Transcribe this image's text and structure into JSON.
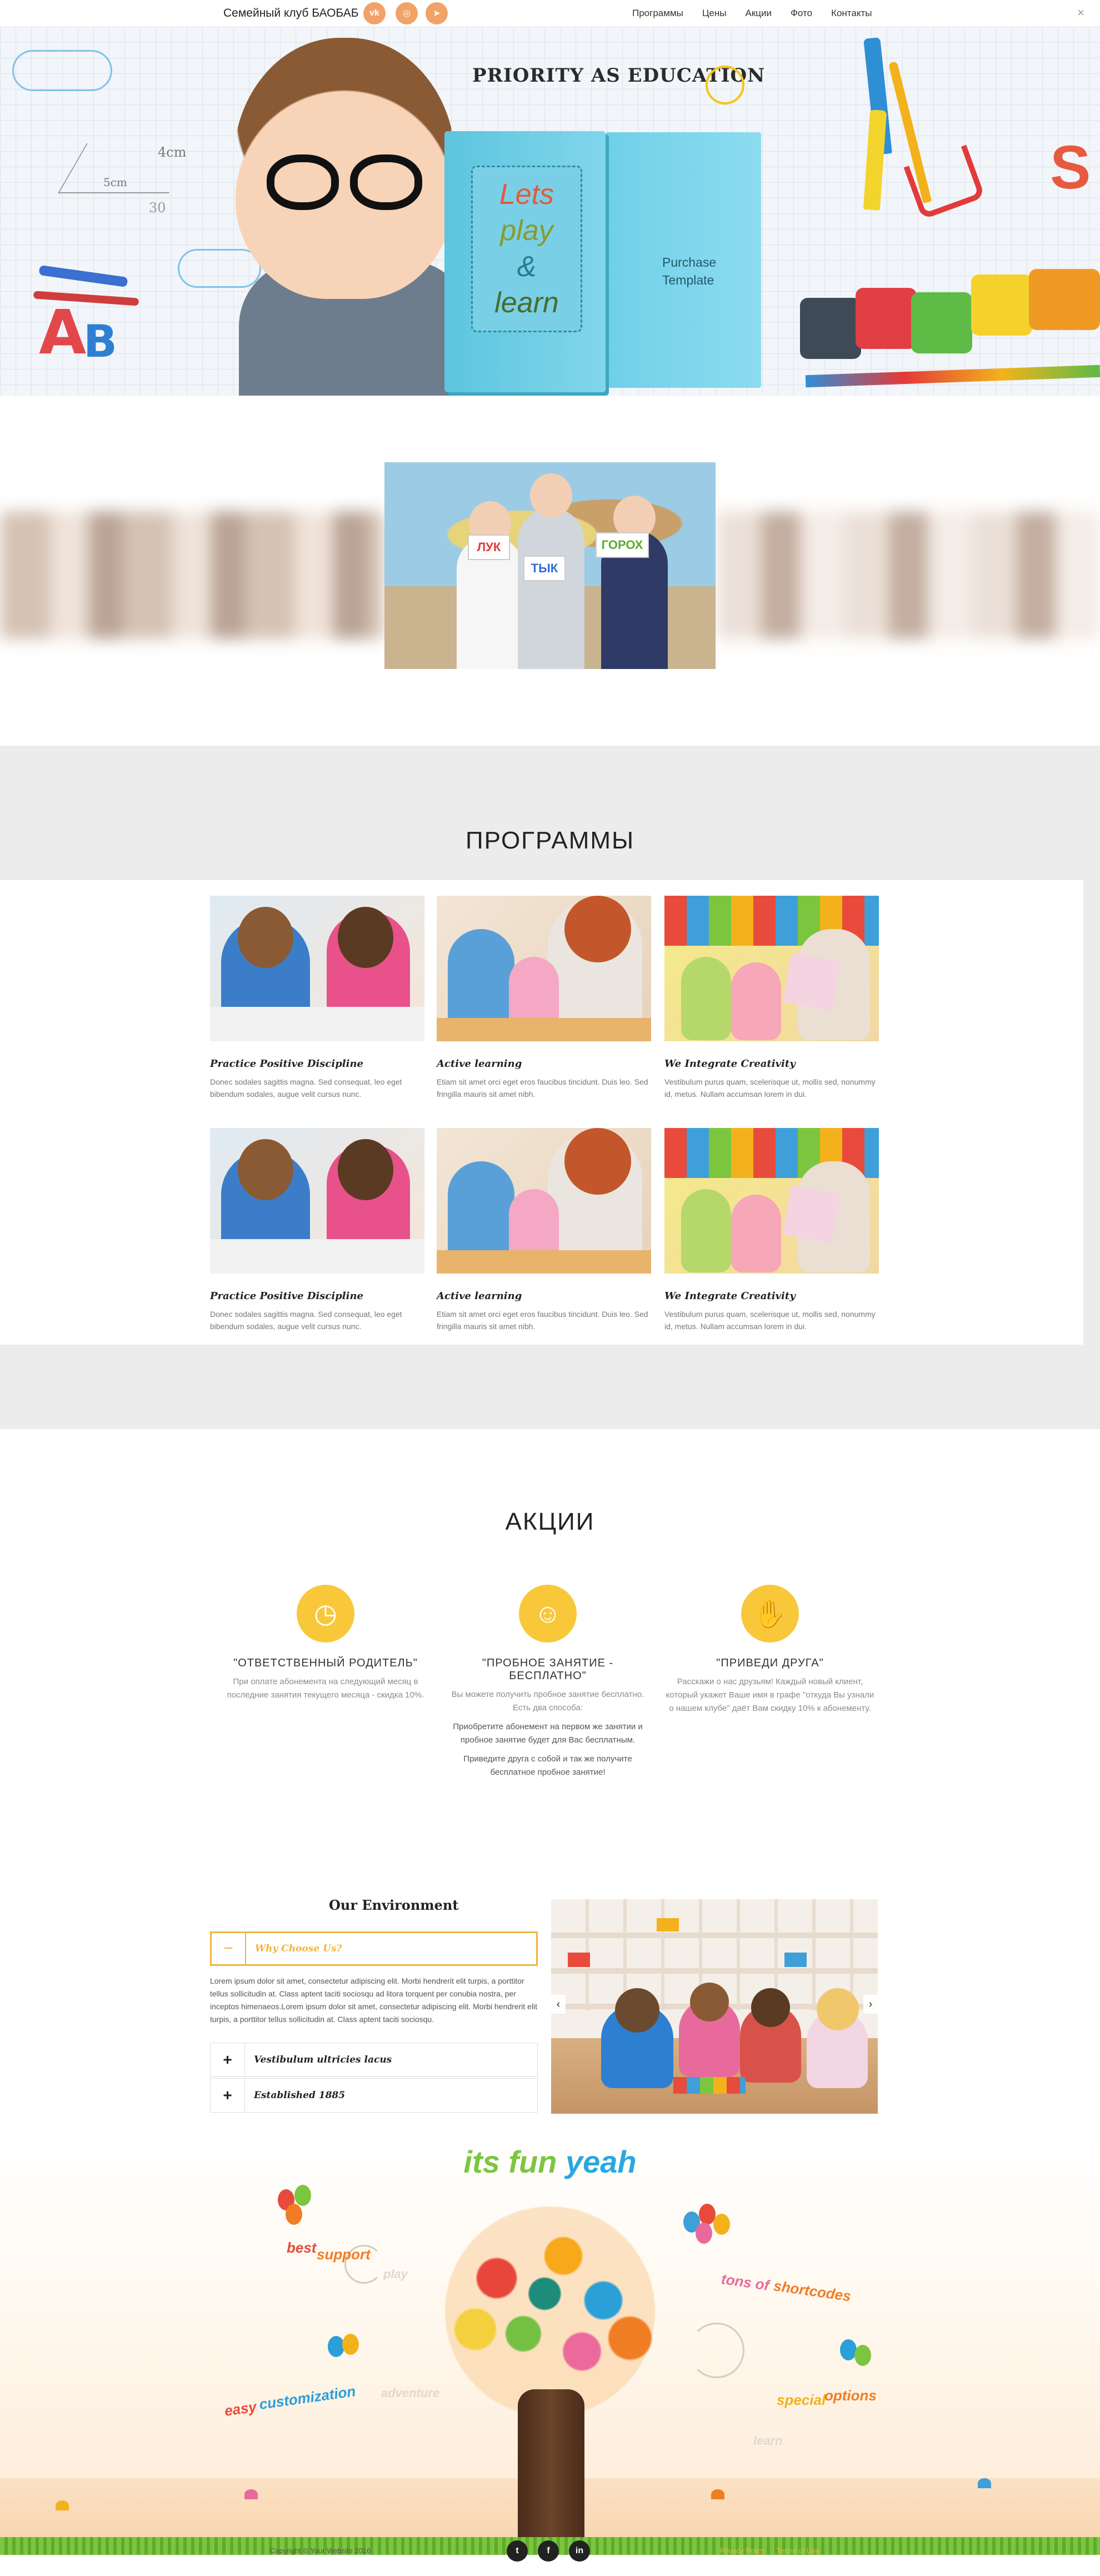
{
  "header": {
    "site_title": "Семейный клуб БАОБАБ",
    "social": [
      {
        "icon": "vk-icon",
        "glyph": "vk"
      },
      {
        "icon": "instagram-icon",
        "glyph": "◎"
      },
      {
        "icon": "telegram-icon",
        "glyph": "➤"
      }
    ],
    "nav": [
      "Программы",
      "Цены",
      "Акции",
      "Фото",
      "Контакты"
    ],
    "close_glyph": "×"
  },
  "hero": {
    "tagline": "PRIORITY AS EDUCATION",
    "book_lines": [
      "Lets",
      "play",
      "&",
      "learn"
    ],
    "purchase_line1": "Purchase",
    "purchase_line2": "Template",
    "chalk_1": "4cm",
    "chalk_2": "5cm",
    "chalk_3": "30",
    "abc_a": "A",
    "abc_b": "B"
  },
  "strip": {
    "cards": [
      "ЛУК",
      "ТЫК",
      "ГОРОХ"
    ]
  },
  "programs": {
    "title": "ПРОГРАММЫ",
    "cards": [
      {
        "title": "Practice Positive Discipline",
        "text": "Donec sodales sagittis magna. Sed consequat, leo eget bibendum sodales, augue velit cursus nunc."
      },
      {
        "title": "Active learning",
        "text": "Etiam sit amet orci eget eros faucibus tincidunt. Duis leo. Sed fringilla mauris sit amet nibh."
      },
      {
        "title": "We Integrate Creativity",
        "text": "Vestibulum purus quam, scelerisque ut, mollis sed, nonummy id, metus. Nullam accumsan lorem in dui."
      },
      {
        "title": "Practice Positive Discipline",
        "text": "Donec sodales sagittis magna. Sed consequat, leo eget bibendum sodales, augue velit cursus nunc."
      },
      {
        "title": "Active learning",
        "text": "Etiam sit amet orci eget eros faucibus tincidunt. Duis leo. Sed fringilla mauris sit amet nibh."
      },
      {
        "title": "We Integrate Creativity",
        "text": "Vestibulum purus quam, scelerisque ut, mollis sed, nonummy id, metus. Nullam accumsan lorem in dui."
      }
    ]
  },
  "akcii": {
    "title": "АКЦИИ",
    "items": [
      {
        "icon": "clock-icon",
        "glyph": "◷",
        "heading": "\"ОТВЕТСТВЕННЫЙ РОДИТЕЛЬ\"",
        "lines": [
          "При оплате абонемента на следующий месяц в последние занятия текущего месяца - скидка 10%."
        ]
      },
      {
        "icon": "child-icon",
        "glyph": "☺",
        "heading": "\"ПРОБНОЕ ЗАНЯТИЕ - БЕСПЛАТНО\"",
        "lines": [
          "Вы можете получить пробное занятие бесплатно. Есть два способа:",
          "Приобретите абонемент на первом же занятии и пробное занятие будет для Вас бесплатным.",
          "Приведите друга с собой и так же получите бесплатное пробное занятие!"
        ]
      },
      {
        "icon": "handshake-icon",
        "glyph": "✋",
        "heading": "\"ПРИВЕДИ ДРУГА\"",
        "lines": [
          "Расскажи о нас друзьям! Каждый новый клиент, который укажет Ваше имя в графе \"откуда Вы узнали о нашем клубе\" даёт Вам скидку 10% к абонементу."
        ]
      }
    ]
  },
  "environment": {
    "title": "Our Environment",
    "open_item": {
      "sign": "−",
      "label": "Why Choose Us?"
    },
    "open_text": "Lorem ipsum dolor sit amet, consectetur adipiscing elit. Morbi hendrerit elit turpis, a porttitor tellus sollicitudin at. Class aptent taciti sociosqu ad litora torquent per conubia nostra, per inceptos himenaeos.Lorem ipsum dolor sit amet, consectetur adipiscing elit. Morbi hendrerit elit turpis, a porttitor tellus sollicitudin at. Class aptent taciti sociosqu.",
    "items": [
      {
        "sign": "+",
        "label": "Vestibulum ultricies lacus"
      },
      {
        "sign": "+",
        "label": "Established 1885"
      }
    ],
    "prev_glyph": "‹",
    "next_glyph": "›"
  },
  "fun": {
    "title_a": "its fun",
    "title_b": "yeah",
    "words": {
      "best_a": "best",
      "best_b": "support",
      "tons_a": "tons of",
      "tons_b": "shortcodes",
      "easy_a": "easy",
      "easy_b": "customization",
      "special_a": "special",
      "special_b": "options",
      "faint_1": "play",
      "faint_2": "learn",
      "faint_3": "adventure"
    }
  },
  "footer": {
    "copyright": "Copyright © Your Website 2016",
    "social": [
      {
        "icon": "twitter-icon",
        "glyph": "t"
      },
      {
        "icon": "facebook-icon",
        "glyph": "f"
      },
      {
        "icon": "linkedin-icon",
        "glyph": "in"
      }
    ],
    "links": [
      "Privacy Policy",
      "Terms of Use"
    ]
  },
  "colors": {
    "accent": "#f2b43a",
    "icon_yellow": "#f8c83a",
    "social_orange": "#f0a268",
    "band_gray": "#ececec"
  }
}
